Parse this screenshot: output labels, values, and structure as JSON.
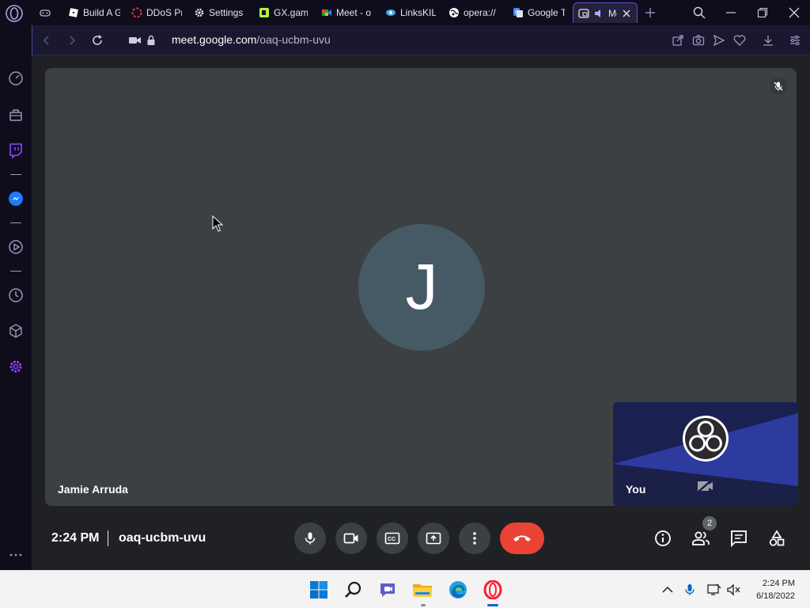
{
  "browser": {
    "tabs": [
      {
        "title": "",
        "icon": "gamepad-icon"
      },
      {
        "title": "Build A G",
        "icon": "roblox-icon"
      },
      {
        "title": "DDoS Pr",
        "icon": "ddos-icon"
      },
      {
        "title": "Settings",
        "icon": "gear-icon"
      },
      {
        "title": "GX.game",
        "icon": "gx-icon"
      },
      {
        "title": "Meet - o",
        "icon": "meet-icon"
      },
      {
        "title": "LinksKILL",
        "icon": "links-icon"
      },
      {
        "title": "opera://",
        "icon": "globe-icon"
      },
      {
        "title": "Google T",
        "icon": "translate-icon"
      },
      {
        "title": "Me",
        "icon": "meet-icon",
        "active": true
      }
    ],
    "address": {
      "url_domain": "meet.google.com",
      "url_path": "/oaq-ucbm-uvu"
    }
  },
  "meet": {
    "participant_initial": "J",
    "participant_name": "Jamie Arruda",
    "self_label": "You",
    "time": "2:24 PM",
    "meeting_code": "oaq-ucbm-uvu",
    "participants_count": "2",
    "colors": {
      "end_call": "#ea4335",
      "stage": "#3c4043",
      "avatar": "#455a64"
    }
  },
  "taskbar": {
    "time": "2:24 PM",
    "date": "6/18/2022"
  }
}
